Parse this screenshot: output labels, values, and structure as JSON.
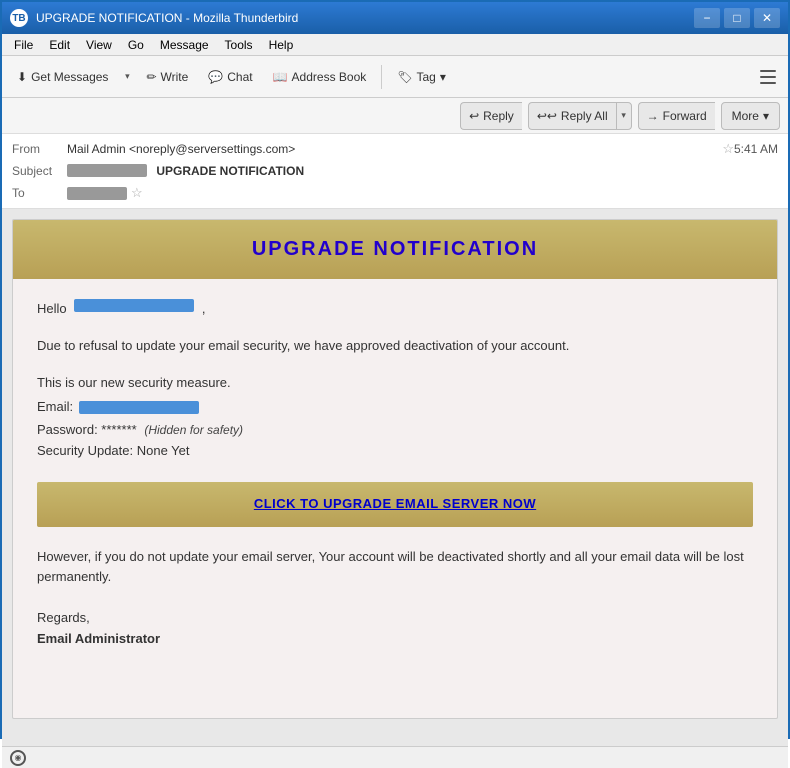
{
  "titleBar": {
    "icon": "TB",
    "title": "UPGRADE NOTIFICATION - Mozilla Thunderbird",
    "minimize": "−",
    "maximize": "□",
    "close": "✕"
  },
  "menuBar": {
    "items": [
      "File",
      "Edit",
      "View",
      "Go",
      "Message",
      "Tools",
      "Help"
    ]
  },
  "toolbar": {
    "getMessages": "Get Messages",
    "write": "Write",
    "chat": "Chat",
    "addressBook": "Address Book",
    "tag": "Tag",
    "dropdownArrow": "▾",
    "hamburger": "☰"
  },
  "actionBar": {
    "reply": "Reply",
    "replyAll": "Reply All",
    "forward": "Forward",
    "more": "More",
    "dropdownArrow": "▾",
    "replyIcon": "↩",
    "replyAllIcon": "↩↩",
    "forwardIcon": "→"
  },
  "emailHeader": {
    "fromLabel": "From",
    "fromName": "Mail Admin <noreply@serversettings.com>",
    "starIcon": "☆",
    "subjectLabel": "Subject",
    "subjectBlurred": "████████████",
    "subjectBold": "UPGRADE NOTIFICATION",
    "time": "5:41 AM",
    "toLabel": "To",
    "toStarIcon": "☆"
  },
  "emailBody": {
    "title": "UPGRADE  NOTIFICATION",
    "helloText": "Hello",
    "helloBlurred": "██████████████",
    "helloPunctuation": ",",
    "para1": "Due to refusal to update your email security, we have approved deactivation of your account.",
    "para2": "This is our new security measure.",
    "emailLabel": "Email:",
    "emailBlurred": "████████████████",
    "passwordLine": "Password: *******",
    "passwordHidden": "(Hidden for safety)",
    "securityLine": "Security Update: None Yet",
    "upgradeBtnText": "CLICK TO UPGRADE EMAIL SERVER NOW",
    "warningText": "However, if you do not update your email server, Your account will be deactivated shortly and all your email data will be lost permanently.",
    "regards": "Regards,",
    "signature": "Email Administrator"
  },
  "statusBar": {
    "icon": "((•))",
    "text": ""
  }
}
